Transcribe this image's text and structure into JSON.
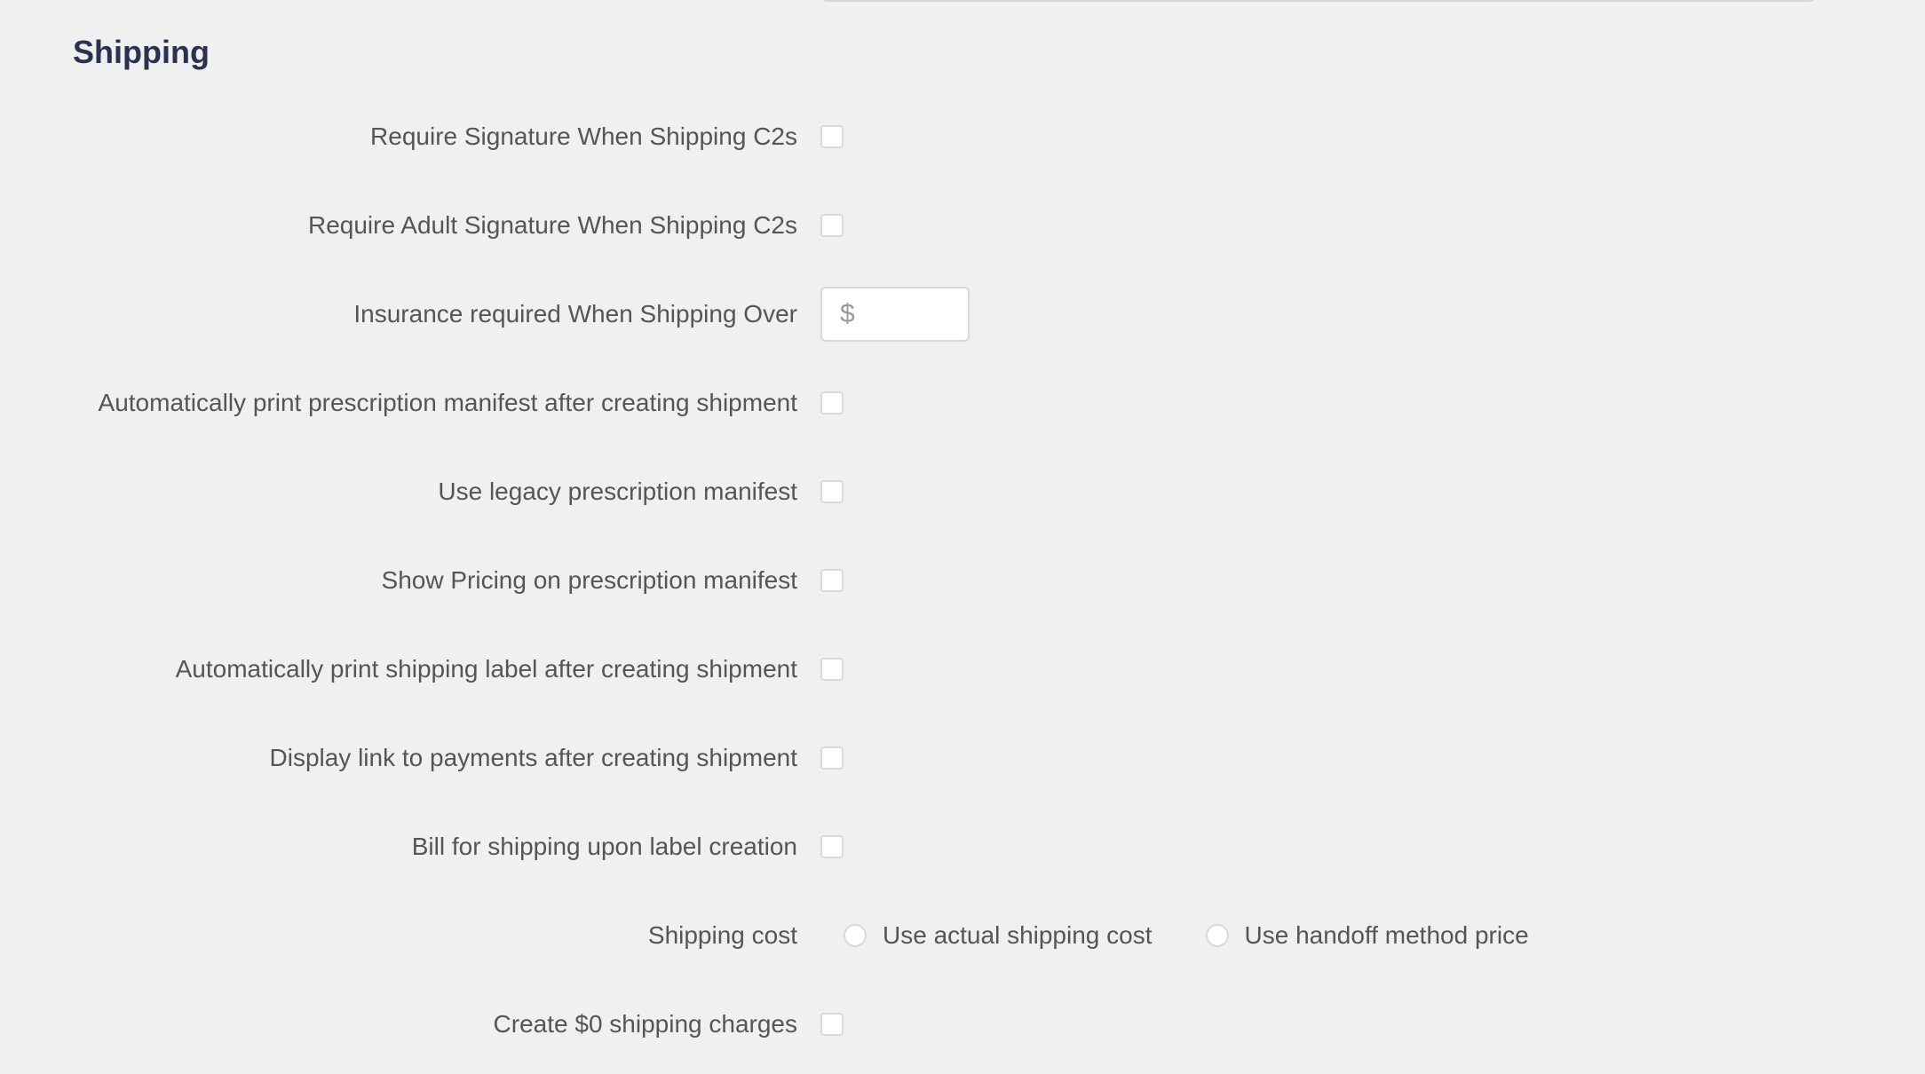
{
  "section": {
    "title": "Shipping"
  },
  "fields": {
    "require_signature": {
      "label": "Require Signature When Shipping C2s",
      "checked": false
    },
    "require_adult_signature": {
      "label": "Require Adult Signature When Shipping C2s",
      "checked": false
    },
    "insurance_over": {
      "label": "Insurance required When Shipping Over",
      "currency_symbol": "$",
      "value": ""
    },
    "auto_print_manifest": {
      "label": "Automatically print prescription manifest after creating shipment",
      "checked": false
    },
    "legacy_manifest": {
      "label": "Use legacy prescription manifest",
      "checked": false
    },
    "show_pricing_manifest": {
      "label": "Show Pricing on prescription manifest",
      "checked": false
    },
    "auto_print_label": {
      "label": "Automatically print shipping label after creating shipment",
      "checked": false
    },
    "display_payments_link": {
      "label": "Display link to payments after creating shipment",
      "checked": false
    },
    "bill_on_label": {
      "label": "Bill for shipping upon label creation",
      "checked": false
    },
    "shipping_cost": {
      "label": "Shipping cost",
      "options": [
        {
          "label": "Use actual shipping cost",
          "selected": false
        },
        {
          "label": "Use handoff method price",
          "selected": false
        }
      ]
    },
    "zero_charges": {
      "label": "Create $0 shipping charges",
      "checked": false
    }
  }
}
